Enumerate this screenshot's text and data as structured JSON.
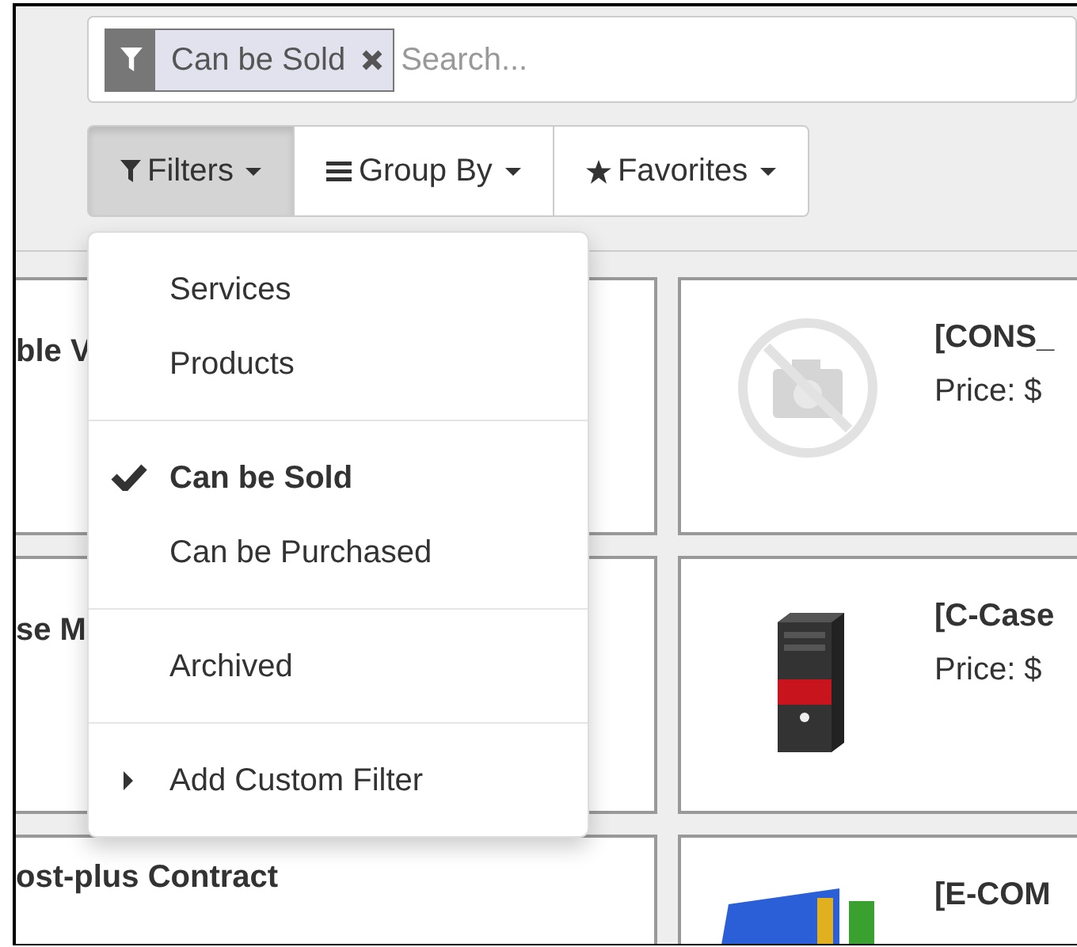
{
  "search": {
    "facets": [
      {
        "label": "Can be Sold"
      }
    ],
    "placeholder": "Search..."
  },
  "toolbar": [
    {
      "kind": "filter",
      "label": "Filters",
      "selected": true
    },
    {
      "kind": "group",
      "label": "Group By",
      "selected": false
    },
    {
      "kind": "favorite",
      "label": "Favorites",
      "selected": false
    }
  ],
  "filters_menu": {
    "sections": [
      [
        {
          "label": "Services",
          "checked": false
        },
        {
          "label": "Products",
          "checked": false
        }
      ],
      [
        {
          "label": "Can be Sold",
          "checked": true
        },
        {
          "label": "Can be Purchased",
          "checked": false
        }
      ],
      [
        {
          "label": "Archived",
          "checked": false
        }
      ]
    ],
    "custom_filter": {
      "label": "Add Custom Filter"
    }
  },
  "cards_left": [
    {
      "title": "ble V"
    },
    {
      "title": "se M"
    },
    {
      "title": "ost-plus Contract"
    }
  ],
  "cards_right": [
    {
      "kind": "placeholder",
      "title": "[CONS_",
      "price": "Price: $"
    },
    {
      "kind": "tower",
      "title": "[C-Case",
      "price": "Price: $"
    },
    {
      "kind": "tools",
      "title": "[E-COM"
    }
  ]
}
